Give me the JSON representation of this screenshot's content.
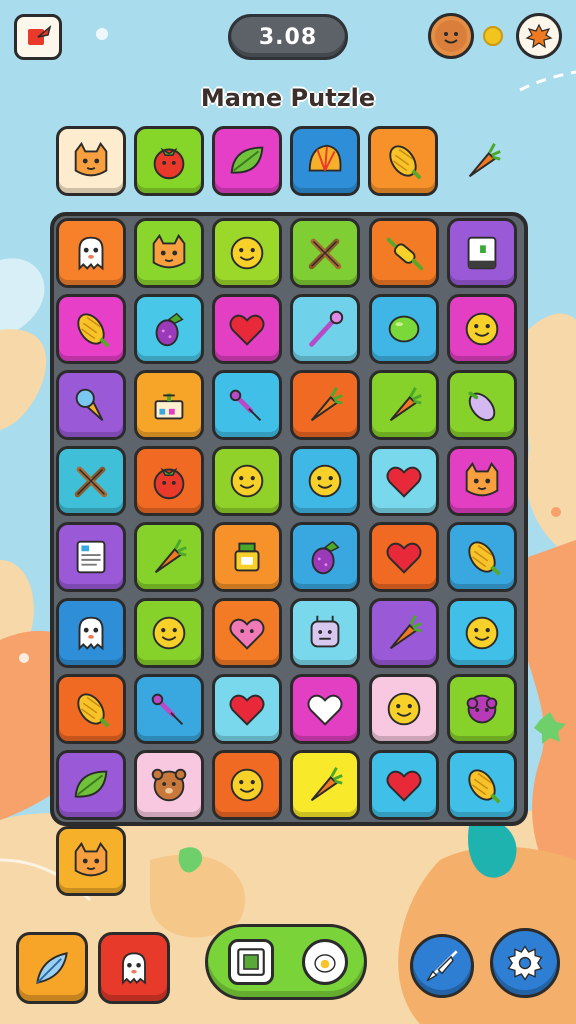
{
  "header": {
    "score": "3.08",
    "title": "Mame Putzle"
  },
  "goals": [
    {
      "icon": "cat-face-icon",
      "color": "#fdeccd"
    },
    {
      "icon": "tomato-icon",
      "color": "#86d629"
    },
    {
      "icon": "leaf-icon",
      "color": "#e43fc6"
    },
    {
      "icon": "shell-icon",
      "color": "#2e8fd8"
    },
    {
      "icon": "corn-icon",
      "color": "#f7922a"
    },
    {
      "icon": "carrot-icon",
      "color": "none"
    }
  ],
  "board": {
    "rows": [
      [
        {
          "icon": "ghost-face-icon",
          "color": "#f7812b"
        },
        {
          "icon": "cat-face-icon",
          "color": "#8ad62c"
        },
        {
          "icon": "smiley-face-icon",
          "color": "#9bd82a"
        },
        {
          "icon": "crossed-sticks-icon",
          "color": "#7fcf34"
        },
        {
          "icon": "rolling-pin-icon",
          "color": "#f47b25"
        },
        {
          "icon": "book-icon",
          "color": "#9a5ad8"
        }
      ],
      [
        {
          "icon": "corn-icon",
          "color": "#e83fc8"
        },
        {
          "icon": "berry-icon",
          "color": "#48c7e8"
        },
        {
          "icon": "heart-icon",
          "color": "#e23fc2"
        },
        {
          "icon": "wand-icon",
          "color": "#6fd2ea"
        },
        {
          "icon": "lime-icon",
          "color": "#3fb6e6"
        },
        {
          "icon": "smiley-face-icon",
          "color": "#e23fc2"
        }
      ],
      [
        {
          "icon": "ice-cream-icon",
          "color": "#9a5ad8"
        },
        {
          "icon": "cake-icon",
          "color": "#f7a529"
        },
        {
          "icon": "brush-icon",
          "color": "#40c0e8"
        },
        {
          "icon": "carrot-icon",
          "color": "#f06a24"
        },
        {
          "icon": "carrot-icon",
          "color": "#86d12a"
        },
        {
          "icon": "eggplant-icon",
          "color": "#86d12a"
        }
      ],
      [
        {
          "icon": "crossed-sticks-icon",
          "color": "#3fbfd8"
        },
        {
          "icon": "tomato-icon",
          "color": "#f06a24"
        },
        {
          "icon": "smiley-face-icon",
          "color": "#90d22a"
        },
        {
          "icon": "smiley-face-icon",
          "color": "#40b8e6"
        },
        {
          "icon": "heart-icon",
          "color": "#7ad8ec"
        },
        {
          "icon": "cat-face-icon",
          "color": "#e23fc2"
        }
      ],
      [
        {
          "icon": "note-icon",
          "color": "#9a5ad8"
        },
        {
          "icon": "carrot-icon",
          "color": "#86d12a"
        },
        {
          "icon": "jar-icon",
          "color": "#f7922a"
        },
        {
          "icon": "berry-icon",
          "color": "#3aa8e0"
        },
        {
          "icon": "heart-icon",
          "color": "#f06a24"
        },
        {
          "icon": "corn-icon",
          "color": "#3aa8e0"
        }
      ],
      [
        {
          "icon": "ghost-face-icon",
          "color": "#2e8fd8"
        },
        {
          "icon": "smiley-face-icon",
          "color": "#86d12a"
        },
        {
          "icon": "heart-face-icon",
          "color": "#f47b25"
        },
        {
          "icon": "robot-face-icon",
          "color": "#7ad8ec"
        },
        {
          "icon": "carrot-icon",
          "color": "#9a5ad8"
        },
        {
          "icon": "smiley-face-icon",
          "color": "#40c0e8"
        }
      ],
      [
        {
          "icon": "corn-icon",
          "color": "#f06a24"
        },
        {
          "icon": "brush-icon",
          "color": "#3aa8e0"
        },
        {
          "icon": "heart-icon",
          "color": "#7ad8ec"
        },
        {
          "icon": "heart-outline-icon",
          "color": "#e23fc2"
        },
        {
          "icon": "smiley-face-icon",
          "color": "#f8c8e0"
        },
        {
          "icon": "berry-blob-icon",
          "color": "#86d12a"
        }
      ],
      [
        {
          "icon": "leaf-icon",
          "color": "#9a5ad8"
        },
        {
          "icon": "bear-face-icon",
          "color": "#f8c8e0"
        },
        {
          "icon": "smiley-face-icon",
          "color": "#f06a24"
        },
        {
          "icon": "carrot-icon",
          "color": "#f8ea2a"
        },
        {
          "icon": "heart-icon",
          "color": "#40c0e8"
        },
        {
          "icon": "corn-icon",
          "color": "#40c0e8"
        }
      ]
    ]
  },
  "next_tile": {
    "icon": "cat-face-icon",
    "color": "#f7b02a"
  },
  "bottom": {
    "feather_btn": {
      "icon": "feather-icon",
      "color": "#f7a529"
    },
    "ghost_btn": {
      "icon": "ghost-face-icon",
      "color": "#e83a2a"
    },
    "center_left_icon": "frame-icon",
    "center_right_icon": "egg-icon",
    "rocket_btn": {
      "icon": "rocket-icon",
      "color": "#2e7fd4"
    },
    "settings_btn": {
      "icon": "gear-icon",
      "color": "#2e7fd4"
    }
  }
}
